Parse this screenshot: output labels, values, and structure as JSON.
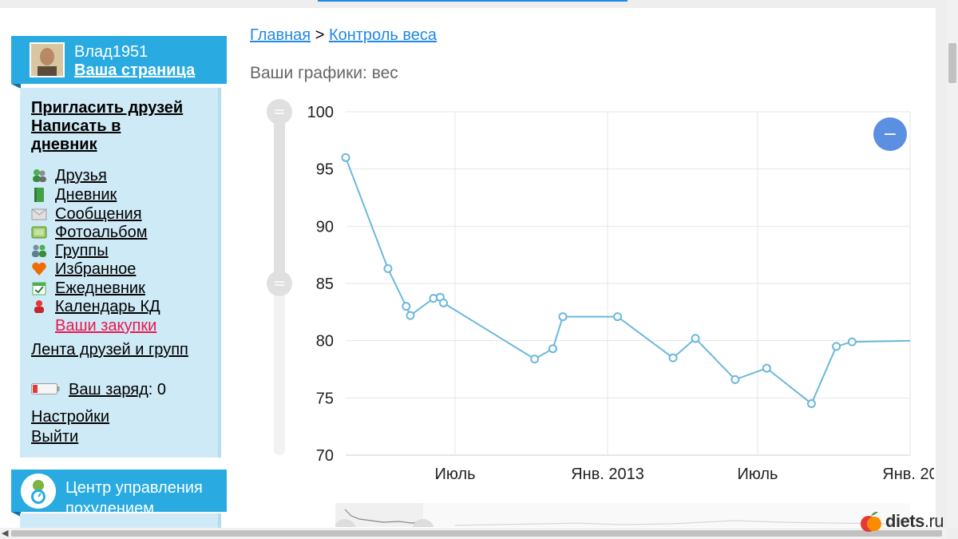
{
  "user": {
    "name": "Влад1951",
    "page_link": "Ваша страница"
  },
  "sidebar": {
    "invite": "Пригласить друзей",
    "write_diary": "Написать в дневник",
    "items": [
      {
        "label": "Друзья",
        "icon": "friends-icon"
      },
      {
        "label": "Дневник",
        "icon": "diary-icon"
      },
      {
        "label": "Сообщения",
        "icon": "messages-icon"
      },
      {
        "label": "Фотоальбом",
        "icon": "photo-album-icon"
      },
      {
        "label": "Группы",
        "icon": "groups-icon"
      },
      {
        "label": "Избранное",
        "icon": "heart-icon"
      },
      {
        "label": "Ежедневник",
        "icon": "planner-icon"
      },
      {
        "label": "Календарь КД",
        "icon": "calendar-kd-icon"
      },
      {
        "label": "Ваши закупки",
        "icon": ""
      }
    ],
    "feed": "Лента друзей и групп",
    "charge_label": "Ваш заряд",
    "charge_value": ": 0",
    "settings": "Настройки",
    "logout": "Выйти",
    "center": "Центр управления похудением"
  },
  "breadcrumb": {
    "home": "Главная",
    "sep": ">",
    "current": "Контроль веса"
  },
  "graph_title": "Ваши графики: вес",
  "chart_data": {
    "type": "line",
    "ylim": [
      70,
      100
    ],
    "yticks": [
      70,
      75,
      80,
      85,
      90,
      95,
      100
    ],
    "xticks": [
      {
        "label": "Июль",
        "date": "2012-07-01"
      },
      {
        "label": "Янв. 2013",
        "date": "2013-01-01"
      },
      {
        "label": "Июль",
        "date": "2013-07-01"
      },
      {
        "label": "Янв. 20",
        "date": "2014-01-01"
      }
    ],
    "xlim": [
      "2012-02-20",
      "2014-01-01"
    ],
    "series": [
      {
        "color": "#6bb8db",
        "points": [
          {
            "x": "2012-02-20",
            "y": 96
          },
          {
            "x": "2012-04-11",
            "y": 86.3
          },
          {
            "x": "2012-05-03",
            "y": 83
          },
          {
            "x": "2012-05-08",
            "y": 82.2
          },
          {
            "x": "2012-06-05",
            "y": 83.7
          },
          {
            "x": "2012-06-13",
            "y": 83.8
          },
          {
            "x": "2012-06-17",
            "y": 83.3
          },
          {
            "x": "2012-10-05",
            "y": 78.4
          },
          {
            "x": "2012-10-27",
            "y": 79.3
          },
          {
            "x": "2012-11-08",
            "y": 82.1
          },
          {
            "x": "2013-01-13",
            "y": 82.1
          },
          {
            "x": "2013-03-21",
            "y": 78.5
          },
          {
            "x": "2013-04-17",
            "y": 80.2
          },
          {
            "x": "2013-06-04",
            "y": 76.6
          },
          {
            "x": "2013-07-12",
            "y": 77.6
          },
          {
            "x": "2013-09-04",
            "y": 74.5
          },
          {
            "x": "2013-10-04",
            "y": 79.5
          },
          {
            "x": "2013-10-23",
            "y": 79.9
          },
          {
            "x": "2014-01-01",
            "y": 80
          }
        ]
      }
    ]
  },
  "zoom_out_label": "−",
  "watermark": {
    "name": "diets",
    "tld": ".ru"
  }
}
